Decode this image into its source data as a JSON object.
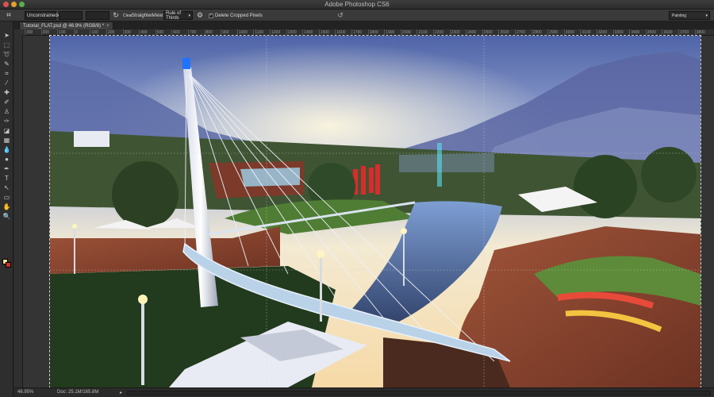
{
  "window": {
    "title": "Adobe Photoshop CS6"
  },
  "options_bar": {
    "ratio_value": "Unconstrained",
    "width_value": "",
    "height_value": "",
    "clear_label": "Clear",
    "straighten_label": "Straighten",
    "view_label": "View:",
    "view_value": "Rule of Thirds",
    "delete_cropped_label": "Delete Cropped Pixels",
    "delete_cropped_checked": true,
    "workspace_value": "Painting"
  },
  "document": {
    "tab_label": "Tutorial_FLAT.psd @ 46.9% (RGB/8) *",
    "zoom": "46.95%",
    "doc_size": "Doc: 25.1M/165.8M"
  },
  "ruler": {
    "marks": [
      "300",
      "200",
      "100",
      "0",
      "100",
      "200",
      "300",
      "400",
      "500",
      "600",
      "700",
      "800",
      "900",
      "1000",
      "1100",
      "1200",
      "1300",
      "1400",
      "1500",
      "1600",
      "1700",
      "1800",
      "1900",
      "2000",
      "2100",
      "2200",
      "2300",
      "2400",
      "2500",
      "2600",
      "2700",
      "2800",
      "2900",
      "3000",
      "3100",
      "3200",
      "3300",
      "3400",
      "3500",
      "3600",
      "3700",
      "3800"
    ]
  },
  "tools": [
    {
      "name": "move-tool-icon",
      "glyph": "➤"
    },
    {
      "name": "marquee-tool-icon",
      "glyph": "⬚"
    },
    {
      "name": "lasso-tool-icon",
      "glyph": "➰"
    },
    {
      "name": "quick-select-tool-icon",
      "glyph": "✎"
    },
    {
      "name": "crop-tool-icon",
      "glyph": "⌗"
    },
    {
      "name": "eyedropper-tool-icon",
      "glyph": "⁄"
    },
    {
      "name": "healing-tool-icon",
      "glyph": "✚"
    },
    {
      "name": "brush-tool-icon",
      "glyph": "✐"
    },
    {
      "name": "clone-stamp-tool-icon",
      "glyph": "♙"
    },
    {
      "name": "history-brush-tool-icon",
      "glyph": "✑"
    },
    {
      "name": "eraser-tool-icon",
      "glyph": "◪"
    },
    {
      "name": "gradient-tool-icon",
      "glyph": "▦"
    },
    {
      "name": "blur-tool-icon",
      "glyph": "💧"
    },
    {
      "name": "dodge-tool-icon",
      "glyph": "●"
    },
    {
      "name": "pen-tool-icon",
      "glyph": "✒"
    },
    {
      "name": "type-tool-icon",
      "glyph": "T"
    },
    {
      "name": "path-select-tool-icon",
      "glyph": "↖"
    },
    {
      "name": "shape-tool-icon",
      "glyph": "▭"
    },
    {
      "name": "hand-tool-icon",
      "glyph": "✋"
    },
    {
      "name": "zoom-tool-icon",
      "glyph": "🔍"
    }
  ],
  "colors": {
    "foreground": "#f2e08a",
    "background": "#c8332a",
    "ui_dark": "#282828",
    "ui_panel": "#3a3a3a"
  }
}
